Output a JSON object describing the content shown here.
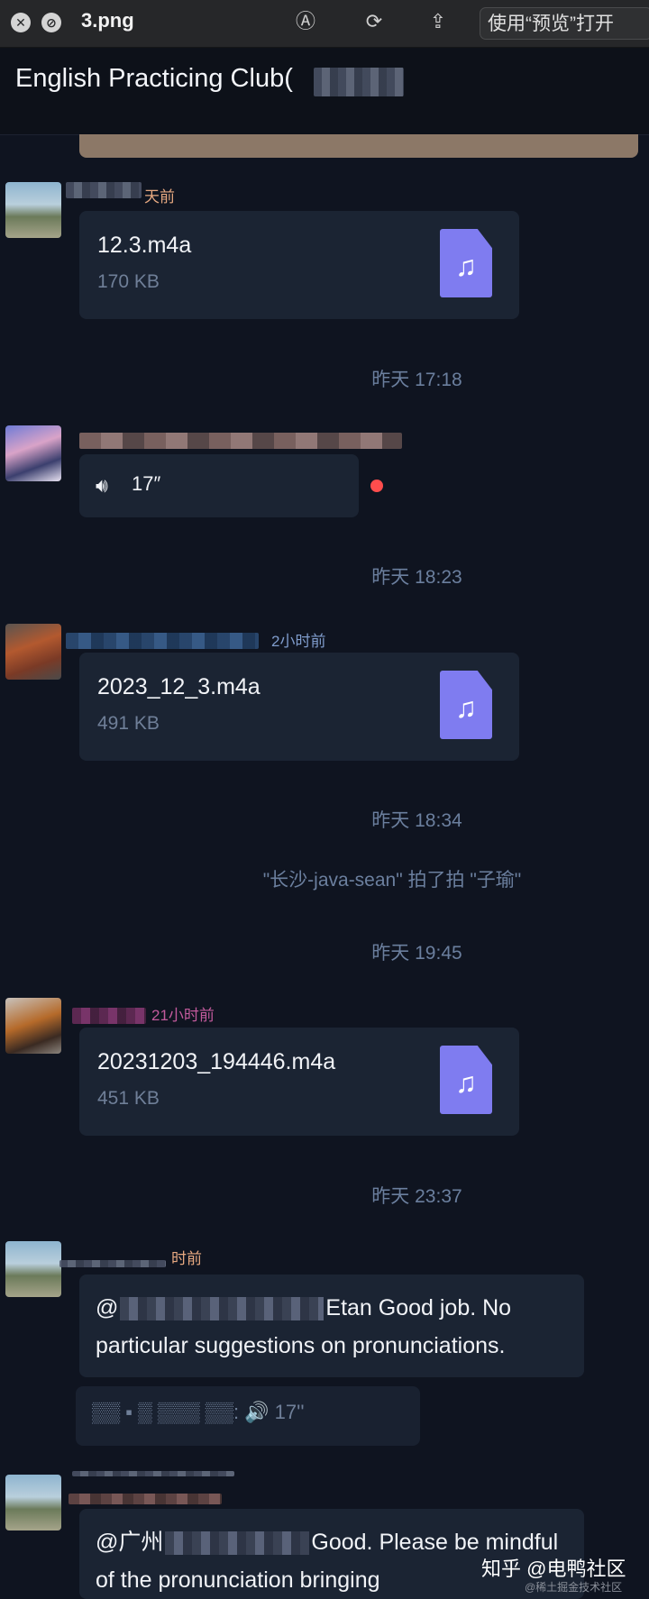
{
  "toolbar": {
    "filename": "3.png",
    "open_with_label": "使用“预览”打开"
  },
  "chat": {
    "title": "English Practicing Club("
  },
  "messages": [
    {
      "time_ago": "天前",
      "file_name": "12.3.m4a",
      "file_size": "170 KB"
    },
    {
      "voice_duration": "17″"
    },
    {
      "time_ago": "2小时前",
      "file_name": "2023_12_3.m4a",
      "file_size": "491 KB"
    },
    {
      "time_ago": "21小时前",
      "file_name": "20231203_194446.m4a",
      "file_size": "451 KB"
    },
    {
      "time_ago": "时前",
      "text_prefix": "@",
      "text_suffix": "Etan Good job. No particular suggestions on pronunciations.",
      "quote": "▒▒ ▪ ▒ ▒▒▒ ▒▒:  🔊 17''"
    },
    {
      "text_prefix": "@广州",
      "text_suffix": "Good. Please be mindful of the pronunciation bringing"
    }
  ],
  "system": {
    "time1": "昨天 17:18",
    "time2": "昨天 18:23",
    "time3": "昨天 18:34",
    "pat": "\"长沙-java-sean\" 拍了拍 \"子瑜\"",
    "time4": "昨天 19:45",
    "time5": "昨天 23:37"
  },
  "watermark": {
    "main": "知乎 @电鸭社区",
    "sub": "@稀土掘金技术社区"
  },
  "colors": {
    "background": "#0f1420",
    "bubble": "#1b2433",
    "file_icon": "#7f7cf0",
    "system_text": "#6b7f9e",
    "unread_dot": "#ff4d4d"
  },
  "icons": [
    "close-icon",
    "blocked-icon",
    "markup-icon",
    "rotate-icon",
    "share-icon",
    "music-note-icon",
    "voice-icon"
  ]
}
